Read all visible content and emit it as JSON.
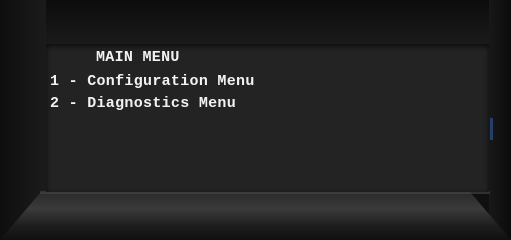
{
  "screen": {
    "title": "MAIN MENU",
    "items": [
      {
        "label": "1 - Configuration Menu"
      },
      {
        "label": "2 - Diagnostics Menu"
      }
    ]
  },
  "colors": {
    "lcd_background": "#232323",
    "lcd_text": "#f2f2f2",
    "bezel": "#141414"
  }
}
